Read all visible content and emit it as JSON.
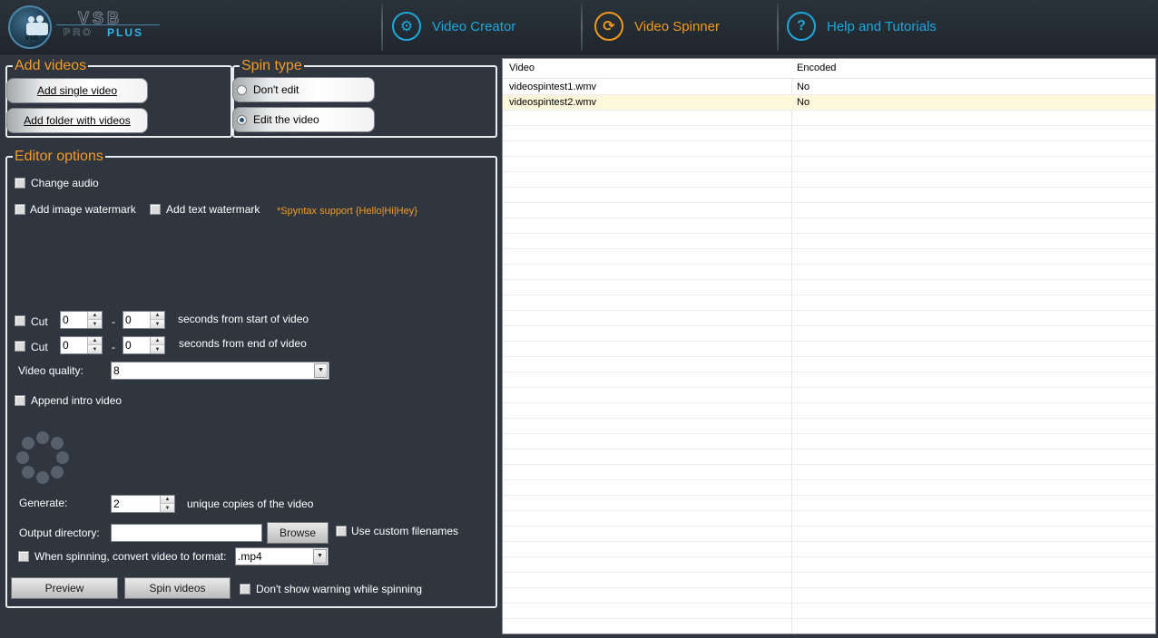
{
  "app": {
    "logo_small": "VSB",
    "brand_top": "VSB",
    "brand_pro": "PRO",
    "brand_plus": "PLUS"
  },
  "nav": [
    {
      "label": "Video Creator",
      "icon": "gear-icon",
      "color": "#1fa7dc"
    },
    {
      "label": "Video Spinner",
      "icon": "refresh-icon",
      "color": "#f19a1c"
    },
    {
      "label": "Help and Tutorials",
      "icon": "help-icon",
      "color": "#1fa7dc"
    }
  ],
  "add_videos": {
    "legend": "Add videos",
    "single": "Add single video",
    "folder": "Add folder with videos"
  },
  "spin_type": {
    "legend": "Spin type",
    "options": [
      "Don't edit",
      "Edit the video"
    ],
    "selected": "Edit the video"
  },
  "editor": {
    "legend": "Editor options",
    "change_audio": "Change audio",
    "add_image_watermark": "Add image watermark",
    "add_text_watermark": "Add text watermark",
    "syntax_note": "*Spyntax support {Hello|Hi|Hey}",
    "cut1": {
      "label": "Cut",
      "from": "0",
      "dash": "-",
      "to": "0",
      "suffix": "seconds from start of video"
    },
    "cut2": {
      "label": "Cut",
      "from": "0",
      "dash": "-",
      "to": "0",
      "suffix": "seconds from end of video"
    },
    "quality_label": "Video quality:",
    "quality_value": "8",
    "append_intro": "Append intro video",
    "generate_label": "Generate:",
    "generate_value": "2",
    "generate_suffix": "unique copies of the video",
    "output_label": "Output directory:",
    "output_value": "",
    "browse": "Browse",
    "custom_filenames": "Use custom filenames",
    "convert_label": "When spinning, convert video to format:",
    "format_value": ".mp4",
    "preview": "Preview",
    "spin_videos": "Spin videos",
    "no_warning": "Don't show warning while spinning"
  },
  "grid": {
    "columns": [
      "Video",
      "Encoded"
    ],
    "rows": [
      {
        "video": "videospintest1.wmv",
        "encoded": "No"
      },
      {
        "video": "videospintest2.wmv",
        "encoded": "No"
      }
    ]
  },
  "colors": {
    "accent_orange": "#f39b26",
    "accent_blue": "#1fa7dc",
    "background": "#2f3640"
  }
}
